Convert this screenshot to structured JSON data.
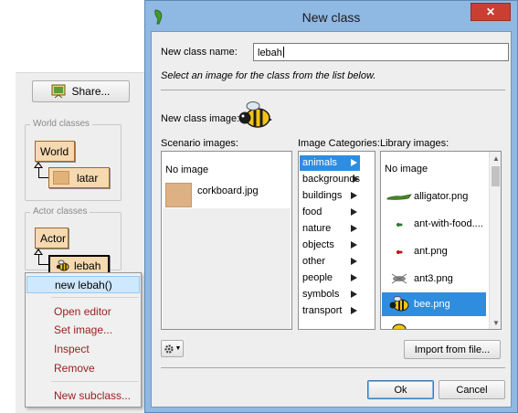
{
  "side": {
    "share_label": "Share...",
    "world_group_title": "World classes",
    "actor_group_title": "Actor classes",
    "classes": {
      "world": "World",
      "latar": "latar",
      "actor": "Actor",
      "lebah": "lebah"
    },
    "context_menu": [
      "new lebah()",
      "Open editor",
      "Set image...",
      "Inspect",
      "Remove",
      "New subclass..."
    ]
  },
  "dialog": {
    "title": "New class",
    "close_label": "✕",
    "name_label": "New class name:",
    "name_value": "lebah",
    "instruction": "Select an image for the class from the list below.",
    "image_label": "New class image:",
    "scenario_header": "Scenario images:",
    "categories_header": "Image Categories:",
    "library_header": "Library images:",
    "scenario_images": [
      "No image",
      "corkboard.jpg"
    ],
    "categories": [
      "animals",
      "backgrounds",
      "buildings",
      "food",
      "nature",
      "objects",
      "other",
      "people",
      "symbols",
      "transport"
    ],
    "selected_category": "animals",
    "library_images": [
      "No image",
      "alligator.png",
      "ant-with-food....",
      "ant.png",
      "ant3.png",
      "bee.png"
    ],
    "selected_library_image": "bee.png",
    "settings_icon": "gear-icon",
    "import_label": "Import from file...",
    "ok_label": "Ok",
    "cancel_label": "Cancel"
  }
}
